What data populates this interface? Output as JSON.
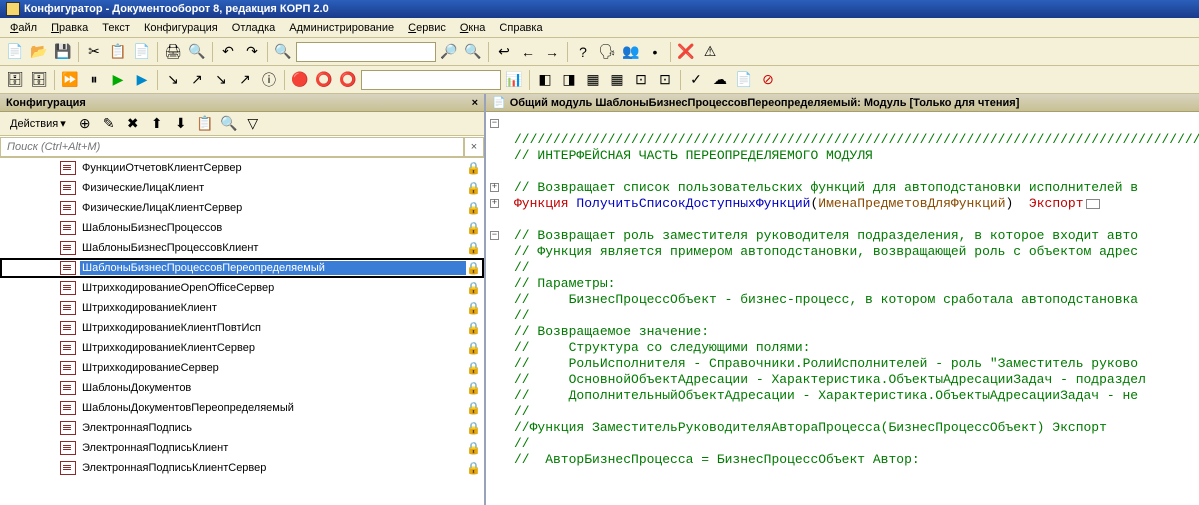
{
  "title": "Конфигуратор - Документооборот 8, редакция КОРП 2.0",
  "menu": {
    "file": "Файл",
    "edit": "Правка",
    "text": "Текст",
    "config": "Конфигурация",
    "debug": "Отладка",
    "admin": "Администрирование",
    "service": "Сервис",
    "windows": "Окна",
    "help": "Справка"
  },
  "toolbar": {
    "new": "📄",
    "open": "📂",
    "save": "💾",
    "cut": "✂",
    "copy": "📋",
    "paste": "📄",
    "print": "🖨",
    "preview": "🔍",
    "undo": "↶",
    "redo": "↷",
    "find": "🔍",
    "combo1": "",
    "zoom_in": "🔎",
    "zoom_out": "🔍",
    "goto": "↩",
    "back": "←",
    "fwd": "→",
    "help": "?",
    "dbadd": "🗣",
    "dbedit": "👥",
    "dbcmp": "•",
    "break": "❌",
    "warn": "⚠"
  },
  "toolbar2": {
    "db1": "🗄",
    "db2": "🗄",
    "db3": "⏩",
    "db4": "⏸",
    "run": "▶",
    "stop": "▶",
    "step1": "↘",
    "step2": "↗",
    "step3": "↘",
    "step4": "↗",
    "info": "ⓘ",
    "bp1": "🔴",
    "bp2": "⭕",
    "bp3": "⭕",
    "combo2": "",
    "calc": "📊",
    "win1": "◧",
    "win2": "◨",
    "win3": "▦",
    "win4": "▦",
    "win5": "⊡",
    "win6": "⊡",
    "add1": "✓",
    "add2": "☁",
    "add3": "📄",
    "stop2": "⊘"
  },
  "config_panel": {
    "title": "Конфигурация",
    "close": "×",
    "actions_label": "Действия",
    "search_placeholder": "Поиск (Ctrl+Alt+M)",
    "items": [
      {
        "label": "ФункцииОтчетовКлиентСервер",
        "locked": true
      },
      {
        "label": "ФизическиеЛицаКлиент",
        "locked": true
      },
      {
        "label": "ФизическиеЛицаКлиентСервер",
        "locked": true
      },
      {
        "label": "ШаблоныБизнесПроцессов",
        "locked": true
      },
      {
        "label": "ШаблоныБизнесПроцессовКлиент",
        "locked": true
      },
      {
        "label": "ШаблоныБизнесПроцессовПереопределяемый",
        "locked": true,
        "selected": true
      },
      {
        "label": "ШтрихкодированиеOpenOfficeСервер",
        "locked": true
      },
      {
        "label": "ШтрихкодированиеКлиент",
        "locked": true
      },
      {
        "label": "ШтрихкодированиеКлиентПовтИсп",
        "locked": true
      },
      {
        "label": "ШтрихкодированиеКлиентСервер",
        "locked": true
      },
      {
        "label": "ШтрихкодированиеСервер",
        "locked": true
      },
      {
        "label": "ШаблоныДокументов",
        "locked": true
      },
      {
        "label": "ШаблоныДокументовПереопределяемый",
        "locked": true
      },
      {
        "label": "ЭлектроннаяПодпись",
        "locked": true
      },
      {
        "label": "ЭлектроннаяПодписьКлиент",
        "locked": true
      },
      {
        "label": "ЭлектроннаяПодписьКлиентСервер",
        "locked": true
      }
    ]
  },
  "code_panel": {
    "title": "Общий модуль ШаблоныБизнесПроцессовПереопределяемый: Модуль [Только для чтения]",
    "lines": [
      {
        "fold": "minus",
        "parts": [
          {
            "cls": "c-green",
            "t": ""
          }
        ]
      },
      {
        "parts": [
          {
            "cls": "c-green",
            "t": "///////////////////////////////////////////////////////////////////////////////////////////////////"
          }
        ]
      },
      {
        "parts": [
          {
            "cls": "c-green",
            "t": "// ИНТЕРФЕЙСНАЯ ЧАСТЬ ПЕРЕОПРЕДЕЛЯЕМОГО МОДУЛЯ"
          }
        ]
      },
      {
        "parts": []
      },
      {
        "fold": "plus",
        "parts": [
          {
            "cls": "c-green",
            "t": "// Возвращает список пользовательских функций для автоподстановки исполнителей в"
          }
        ]
      },
      {
        "fold": "plus",
        "parts": [
          {
            "cls": "c-red",
            "t": "Функция "
          },
          {
            "cls": "c-blue",
            "t": "ПолучитьСписокДоступныхФункций"
          },
          {
            "cls": "c-black",
            "t": "("
          },
          {
            "cls": "c-brown",
            "t": "ИменаПредметовДляФункций"
          },
          {
            "cls": "c-black",
            "t": ")  "
          },
          {
            "cls": "c-red",
            "t": "Экспорт"
          },
          {
            "collapse": true
          }
        ]
      },
      {
        "parts": []
      },
      {
        "fold": "minus",
        "parts": [
          {
            "cls": "c-green",
            "t": "// Возвращает роль заместителя руководителя подразделения, в которое входит авто"
          }
        ]
      },
      {
        "parts": [
          {
            "cls": "c-green",
            "t": "// Функция является примером автоподстановки, возвращающей роль с объектом адрес"
          }
        ]
      },
      {
        "parts": [
          {
            "cls": "c-green",
            "t": "//"
          }
        ]
      },
      {
        "parts": [
          {
            "cls": "c-green",
            "t": "// Параметры:"
          }
        ]
      },
      {
        "parts": [
          {
            "cls": "c-green",
            "t": "//     БизнесПроцессОбъект - бизнес-процесс, в котором сработала автоподстановка "
          }
        ]
      },
      {
        "parts": [
          {
            "cls": "c-green",
            "t": "//"
          }
        ]
      },
      {
        "parts": [
          {
            "cls": "c-green",
            "t": "// Возвращаемое значение:"
          }
        ]
      },
      {
        "parts": [
          {
            "cls": "c-green",
            "t": "//     Структура со следующими полями:"
          }
        ]
      },
      {
        "parts": [
          {
            "cls": "c-green",
            "t": "//     РольИсполнителя - Справочники.РолиИсполнителей - роль \"Заместитель руково"
          }
        ]
      },
      {
        "parts": [
          {
            "cls": "c-green",
            "t": "//     ОсновнойОбъектАдресации - Характеристика.ОбъектыАдресацииЗадач - подраздел"
          }
        ]
      },
      {
        "parts": [
          {
            "cls": "c-green",
            "t": "//     ДополнительныйОбъектАдресации - Характеристика.ОбъектыАдресацииЗадач - не "
          }
        ]
      },
      {
        "parts": [
          {
            "cls": "c-green",
            "t": "//"
          }
        ]
      },
      {
        "parts": [
          {
            "cls": "c-green",
            "t": "//Функция ЗаместительРуководителяАвтораПроцесса(БизнесПроцессОбъект) Экспорт"
          }
        ]
      },
      {
        "parts": [
          {
            "cls": "c-green",
            "t": "//"
          }
        ]
      },
      {
        "parts": [
          {
            "cls": "c-green",
            "t": "//  АвторБизнесПроцесса = БизнесПроцессОбъект Автор:"
          }
        ]
      }
    ]
  }
}
